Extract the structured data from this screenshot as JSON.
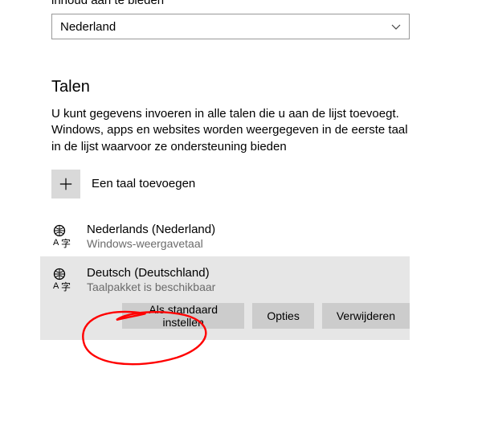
{
  "top": {
    "cut_text": "inhoud aan te bieden",
    "country_selected": "Nederland"
  },
  "languages": {
    "heading": "Talen",
    "description": "U kunt gegevens invoeren in alle talen die u aan de lijst toevoegt. Windows, apps en websites worden weergegeven in de eerste taal in de lijst waarvoor ze ondersteuning bieden",
    "add_label": "Een taal toevoegen",
    "items": [
      {
        "name": "Nederlands (Nederland)",
        "sub": "Windows-weergavetaal"
      },
      {
        "name": "Deutsch (Deutschland)",
        "sub": "Taalpakket is beschikbaar"
      }
    ],
    "buttons": {
      "set_default": "Als standaard instellen",
      "options": "Opties",
      "remove": "Verwijderen"
    }
  },
  "annotation": {
    "color": "#ff0000"
  }
}
